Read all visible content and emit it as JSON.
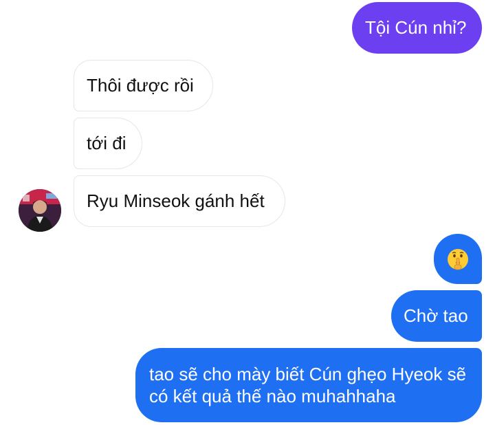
{
  "messages": [
    {
      "id": "b1",
      "side": "sent",
      "text": "Tội Cún nhỉ?"
    },
    {
      "id": "b2",
      "side": "received",
      "text": "Thôi được rồi"
    },
    {
      "id": "b3",
      "side": "received",
      "text": "tới đi"
    },
    {
      "id": "b4",
      "side": "received",
      "text": "Ryu Minseok gánh hết"
    },
    {
      "id": "b5",
      "side": "sent",
      "emoji": "shushing-face"
    },
    {
      "id": "b6",
      "side": "sent",
      "text": "Chờ tao"
    },
    {
      "id": "b7",
      "side": "sent",
      "text": "tao sẽ cho mày biết Cún ghẹo Hyeok sẽ có kết quả thế nào muhahhaha"
    }
  ],
  "colors": {
    "sent_gradient_top": "#6c3ff0",
    "sent_gradient_bottom": "#1f6ff3",
    "received_bg": "#ffffff",
    "received_border": "#e6e6e6"
  }
}
